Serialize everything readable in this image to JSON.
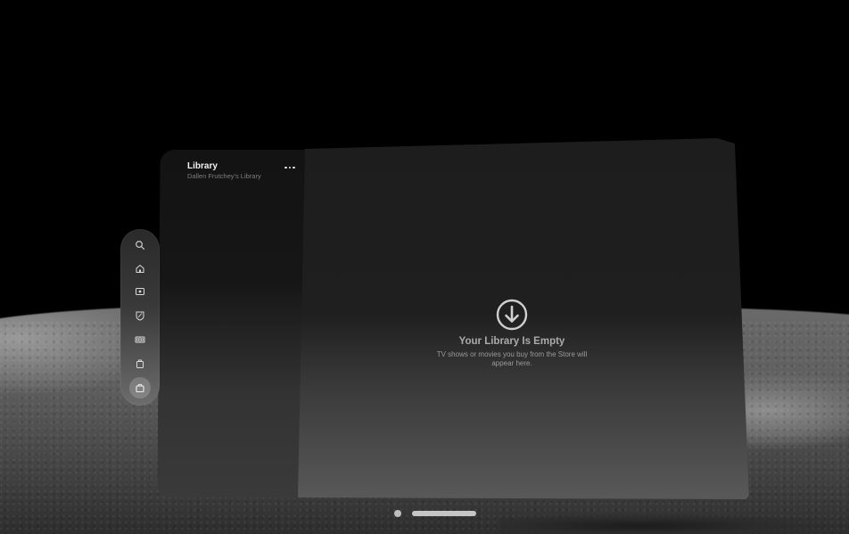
{
  "sidebar": {
    "title": "Library",
    "subtitle": "Dallen Frutchey's Library",
    "more_icon": "ellipsis-icon"
  },
  "empty_state": {
    "icon": "download-circle-icon",
    "title": "Your Library Is Empty",
    "message": "TV shows or movies you buy from the Store will appear here."
  },
  "tabbar": {
    "tabs": [
      {
        "icon": "search-icon"
      },
      {
        "icon": "home-icon"
      },
      {
        "icon": "store-icon"
      },
      {
        "icon": "mls-icon"
      },
      {
        "icon": "sports-icon"
      },
      {
        "icon": "library-icon"
      },
      {
        "icon": "bag-icon",
        "selected": true
      }
    ]
  },
  "colors": {
    "text_primary": "#f2f2f2",
    "text_secondary": "#7e7e7e",
    "empty_text": "#ababab"
  }
}
